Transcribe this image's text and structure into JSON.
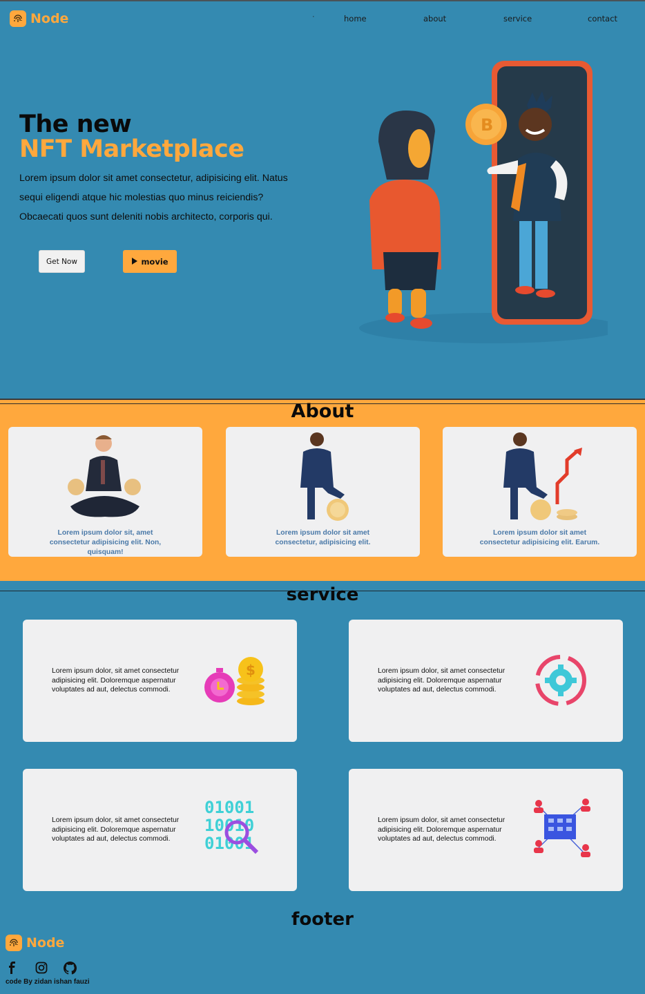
{
  "brand": {
    "name": "Node"
  },
  "nav": {
    "items": [
      "home",
      "about",
      "service",
      "contact"
    ],
    "separator": "·"
  },
  "hero": {
    "title_line1": "The new",
    "title_line2": "NFT Marketplace",
    "text": "Lorem ipsum dolor sit amet consectetur, adipisicing elit. Natus sequi eligendi atque hic molestias quo minus reiciendis? Obcaecati quos sunt deleniti nobis architecto, corporis qui.",
    "btn_get": "Get Now",
    "btn_movie": "movie"
  },
  "about": {
    "title": "About",
    "cards": [
      {
        "text": "Lorem ipsum dolor sit, amet consectetur adipisicing elit. Non, quisquam!"
      },
      {
        "text": "Lorem ipsum dolor sit amet consectetur, adipisicing elit."
      },
      {
        "text": "Lorem ipsum dolor sit amet consectetur adipisicing elit. Earum."
      }
    ]
  },
  "service": {
    "title": "service",
    "cards": [
      {
        "text": "Lorem ipsum dolor, sit amet consectetur adipisicing elit. Doloremque aspernatur voluptates ad aut, delectus commodi.",
        "icon": "stopwatch-coins-icon"
      },
      {
        "text": "Lorem ipsum dolor, sit amet consectetur adipisicing elit. Doloremque aspernatur voluptates ad aut, delectus commodi.",
        "icon": "gear-cycle-icon"
      },
      {
        "text": "Lorem ipsum dolor, sit amet consectetur adipisicing elit. Doloremque aspernatur voluptates ad aut, delectus commodi.",
        "icon": "binary-search-icon"
      },
      {
        "text": "Lorem ipsum dolor, sit amet consectetur adipisicing elit. Doloremque aspernatur voluptates ad aut, delectus commodi.",
        "icon": "network-building-icon"
      }
    ]
  },
  "footer": {
    "title": "footer",
    "brand": "Node",
    "social": [
      "facebook-icon",
      "instagram-icon",
      "github-icon"
    ],
    "credit": "code By zidan ishan fauzi"
  },
  "colors": {
    "background": "#348ab1",
    "accent": "#ffa83d",
    "card": "#f0f0f1",
    "about_text": "#4a79a8"
  }
}
